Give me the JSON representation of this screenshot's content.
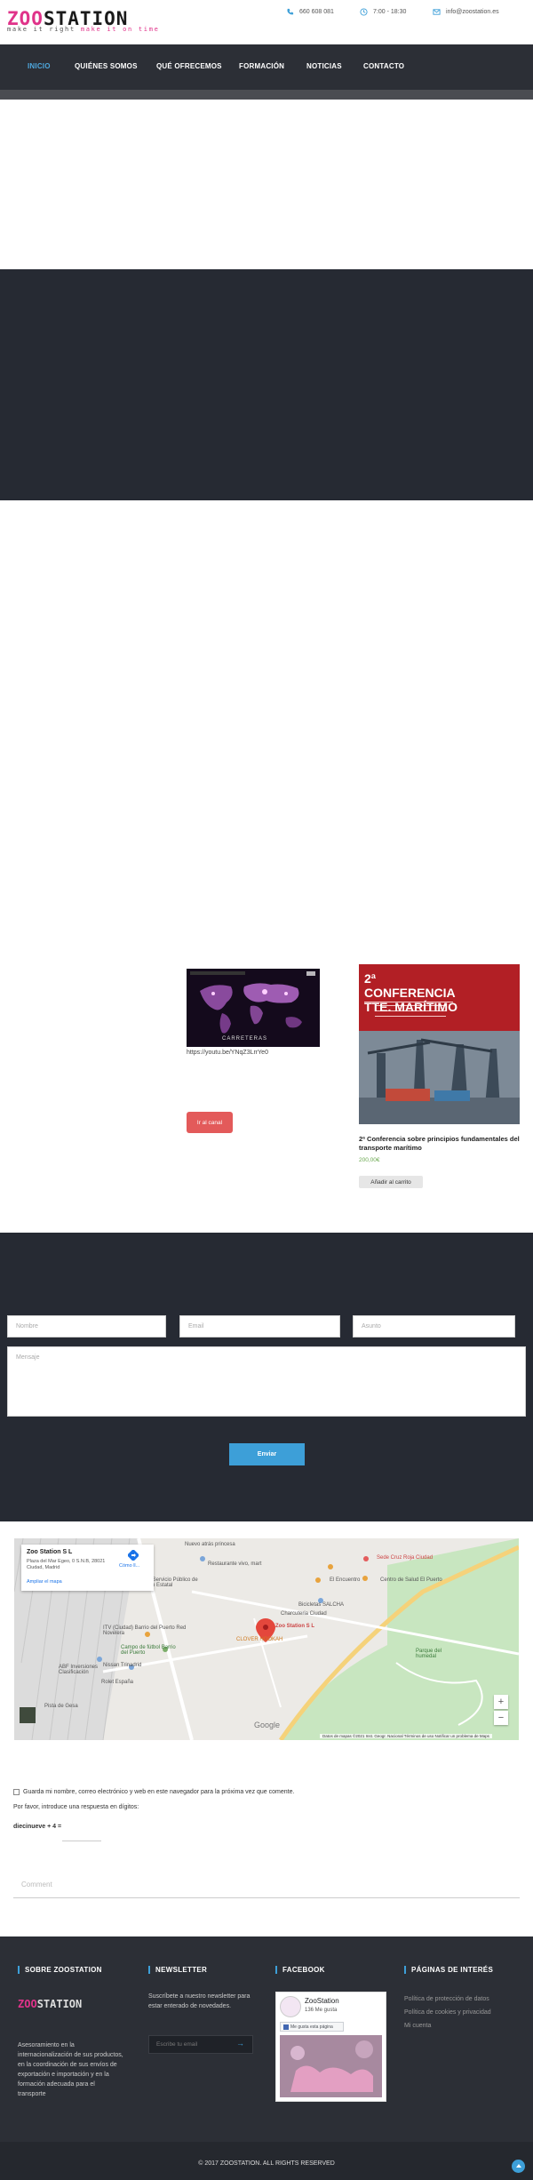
{
  "header": {
    "logo_part1": "ZOO",
    "logo_part2": "STATION",
    "tagline_part1": "make it right",
    "tagline_part2": "make it on time",
    "phone": "660 608 081",
    "hours": "7:00 - 18:30",
    "email": "info@zoostation.es"
  },
  "nav": {
    "items": [
      "INICIO",
      "QUIÉNES SOMOS",
      "QUÉ OFRECEMOS",
      "FORMACIÓN",
      "NOTICIAS",
      "CONTACTO"
    ],
    "active": "INICIO"
  },
  "video": {
    "caption": "CARRETERAS",
    "url": "https://youtu.be/YNqZ3LrrYe0",
    "button_label": "Ir al canal"
  },
  "product": {
    "image_title": "2ª CONFERENCIA TTE. MARÍTIMO",
    "title": "2ª Conferencia sobre principios fundamentales del transporte marítimo",
    "price": "200,00€",
    "cart_label": "Añadir al carrito"
  },
  "contact_form": {
    "name_placeholder": "Nombre",
    "email_placeholder": "Email",
    "subject_placeholder": "Asunto",
    "message_placeholder": "Mensaje",
    "submit_label": "Enviar"
  },
  "map": {
    "place_name": "Zoo Station S L",
    "address_line1": "Plaza del Mar Egeo, 0 S.N.B, 28021",
    "address_line2": "Ciudad, Madrid",
    "directions": "Cómo ll...",
    "enlarge": "Ampliar el mapa",
    "pin_label": "Zoo Station S L",
    "places": [
      "Sede Cruz Roja Ciudad",
      "Restaurante vivo, mart",
      "SEPE Servicio Público de Empleo Estatal",
      "Charcuteria Ciudad",
      "CLOVER HOOKAH",
      "Campo de fútbol Barrio del Puerto",
      "ITV (Ciudad) Barrio del Puerto Red Novelera",
      "Nissan Trinadrid",
      "ABF Inversiones Clasificación",
      "Pista de Gesa",
      "Centro de Salud El Puerto",
      "Parque del humedal",
      "Bicicletas SALCHA",
      "Rolet España",
      "El Encuentro",
      "Nuevo atrás princesa"
    ],
    "footer": "Datos de mapas ©2021 Inst. Geogr. Nacional   Términos de uso   Notificar un problema de Maps",
    "brand": "Google"
  },
  "comments": {
    "save_label": "Guarda mi nombre, correo electrónico y web en este navegador para la próxima vez que comente.",
    "captcha_prompt": "Por favor, introduce una respuesta en dígitos:",
    "captcha_question": "diecinueve + 4 =",
    "comment_placeholder": "Comment"
  },
  "footer": {
    "about_heading": "SOBRE ZOOSTATION",
    "about_text": "Asesoramiento en la internacionalización de sus productos, en la coordinación de sus envíos de exportación e importación y en la formación adecuada para el transporte",
    "newsletter_heading": "NEWSLETTER",
    "newsletter_text": "Suscríbete a nuestro newsletter para estar enterado de novedades.",
    "newsletter_placeholder": "Escribe tu email",
    "facebook_heading": "FACEBOOK",
    "fb_page_name": "ZooStation",
    "fb_likes": "136 Me gusta",
    "fb_like_button": "Me gusta esta página",
    "interest_heading": "PÁGINAS DE INTERÉS",
    "interest_links": [
      "Política de protección de datos",
      "Política de cookies y privacidad",
      "Mi cuenta"
    ],
    "copyright": "© 2017 ZOOSTATION. ALL RIGHTS RESERVED"
  },
  "colors": {
    "brand_pink": "#e0338a",
    "accent_blue": "#3d9fd8",
    "dark_bg": "#262a33",
    "nav_bg": "#2c2f36",
    "button_red": "#e35a5a"
  }
}
